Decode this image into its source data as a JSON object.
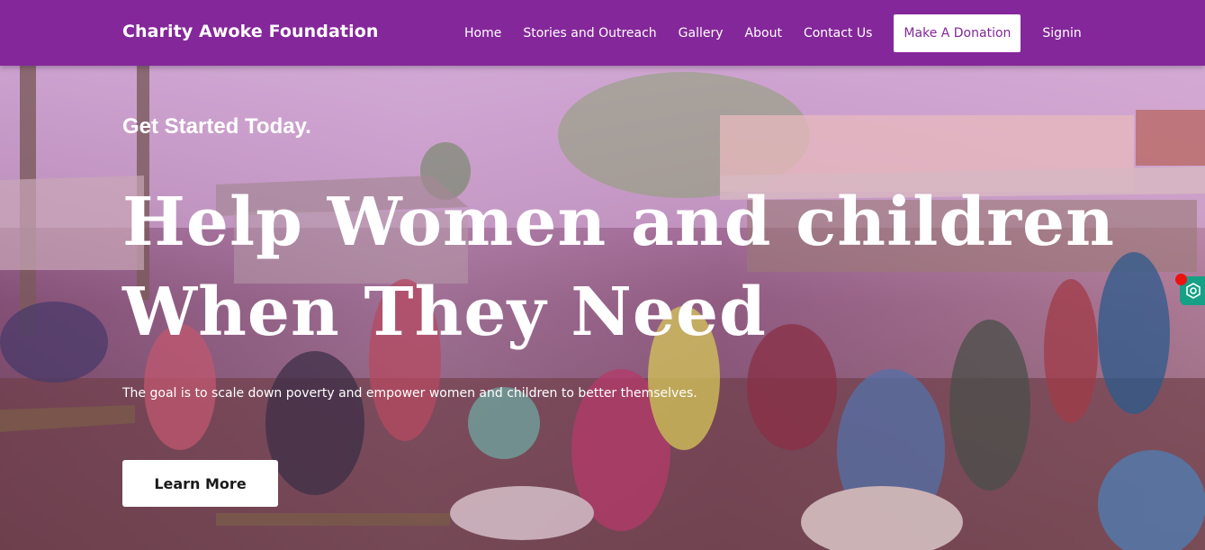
{
  "navbar": {
    "brand": "Charity Awoke Foundation",
    "links": [
      {
        "label": "Home"
      },
      {
        "label": "Stories and Outreach"
      },
      {
        "label": "Gallery"
      },
      {
        "label": "About"
      },
      {
        "label": "Contact Us"
      }
    ],
    "donate_label": "Make A Donation",
    "signin_label": "Signin",
    "background": "#84279a"
  },
  "hero": {
    "eyebrow": "Get Started Today.",
    "headline": "Help Women and children When They Need",
    "tagline": "The goal is to scale down poverty and empower women and children to better themselves.",
    "cta_label": "Learn More",
    "image_description_icon": "market-scene-photo"
  },
  "widgets": {
    "extension_icon": "hexagon-gear-icon",
    "extension_color": "#16a085",
    "notification_dot_color": "#ee1111"
  }
}
